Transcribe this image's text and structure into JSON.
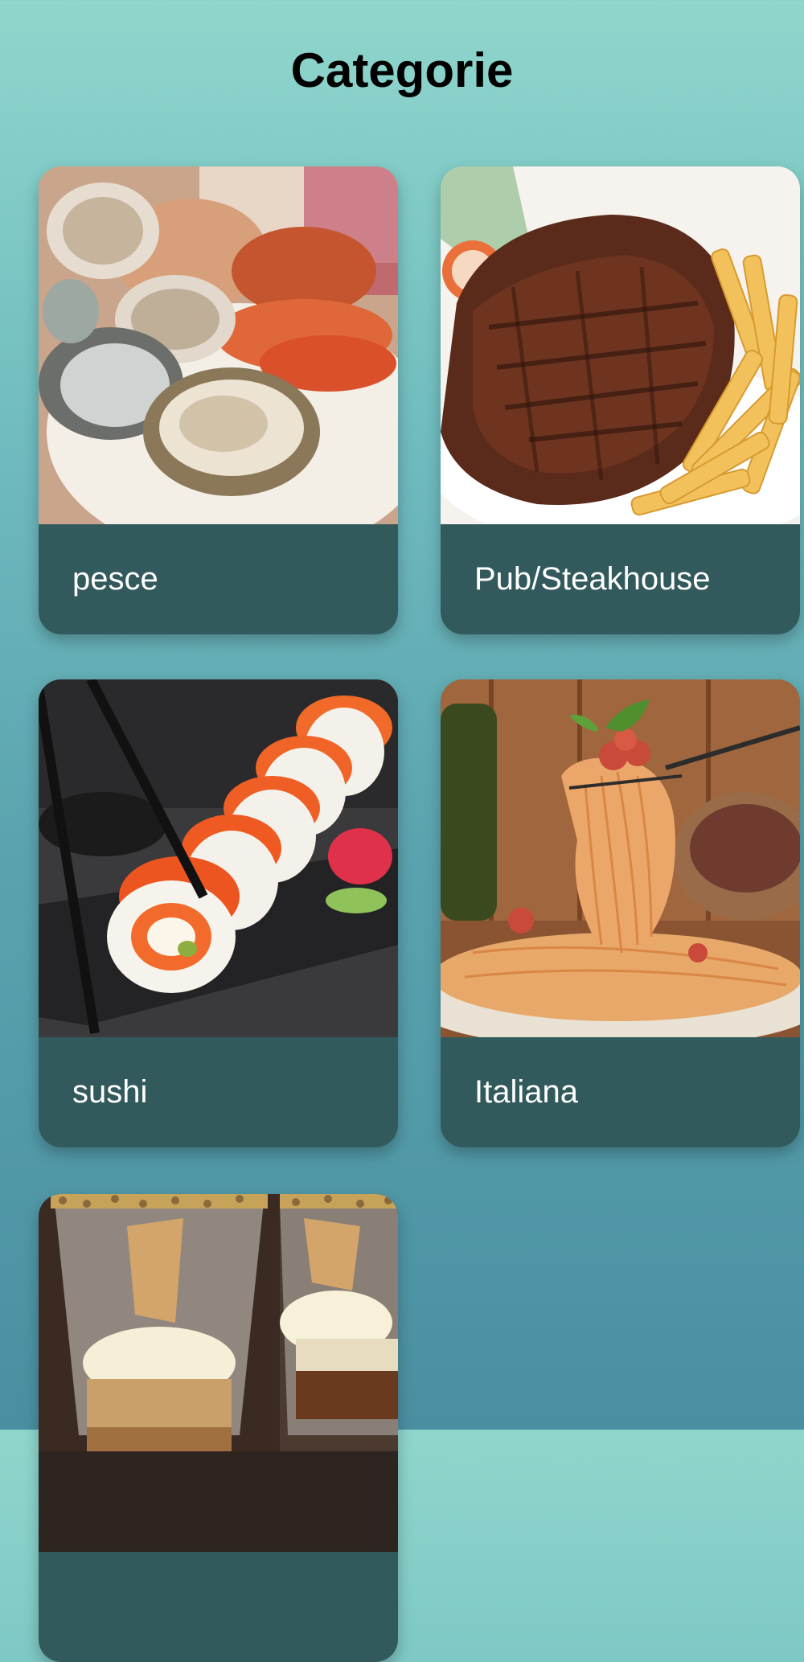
{
  "header": {
    "title": "Categorie"
  },
  "categories": [
    {
      "label": "pesce",
      "image_icon": "seafood-photo"
    },
    {
      "label": "Pub/Steakhouse",
      "image_icon": "steak-photo"
    },
    {
      "label": "sushi",
      "image_icon": "sushi-photo"
    },
    {
      "label": "Italiana",
      "image_icon": "pasta-photo"
    },
    {
      "label": "",
      "image_icon": "dessert-photo"
    }
  ],
  "colors": {
    "card_label_bg": "#325a5c",
    "card_label_text": "#ffffff",
    "title_text": "#000000",
    "bg_top": "#8fd6cc",
    "bg_bottom": "#4a8fa1"
  }
}
